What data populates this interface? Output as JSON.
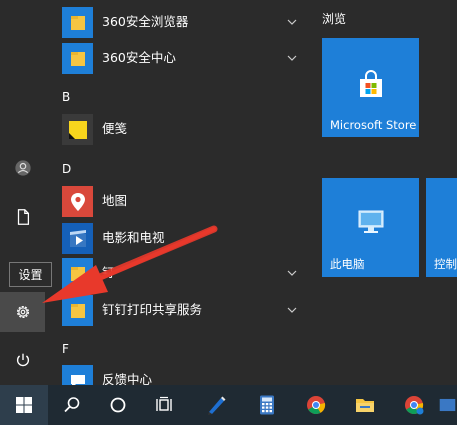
{
  "colors": {
    "background": "#2b2b2b",
    "tile_blue": "#1e7fd8",
    "folder_yellow": "#f5c542",
    "taskbar": "#1f2a33",
    "arrow_red": "#e8392b"
  },
  "rail": {
    "tooltip": "设置",
    "buttons": [
      "user-icon",
      "document-icon",
      "settings-icon",
      "power-icon"
    ]
  },
  "applist": {
    "apps": [
      {
        "label": "360安全浏览器",
        "icon": "folder-icon",
        "expandable": true
      },
      {
        "label": "360安全中心",
        "icon": "folder-icon",
        "expandable": true
      },
      {
        "label": "便笺",
        "icon": "sticky-notes-icon",
        "expandable": false
      },
      {
        "label": "地图",
        "icon": "maps-icon",
        "expandable": false
      },
      {
        "label": "电影和电视",
        "icon": "movies-tv-icon",
        "expandable": false
      },
      {
        "label": "钉",
        "icon": "folder-icon",
        "expandable": true
      },
      {
        "label": "钉钉打印共享服务",
        "icon": "folder-icon",
        "expandable": true
      },
      {
        "label": "反馈中心",
        "icon": "feedback-icon",
        "expandable": false
      }
    ],
    "letters": [
      "B",
      "D",
      "F"
    ]
  },
  "tiles": {
    "group_title": "浏览",
    "items": [
      {
        "label": "Microsoft Store",
        "icon": "store-icon"
      },
      {
        "label": "此电脑",
        "icon": "this-pc-icon"
      },
      {
        "label": "控制",
        "icon": "control-panel-icon"
      }
    ]
  },
  "taskbar": {
    "items": [
      "windows-start-icon",
      "search-icon",
      "cortana-icon",
      "task-view-icon",
      "pen-app-icon",
      "calculator-icon",
      "chrome-icon",
      "file-explorer-icon",
      "chrome-icon"
    ]
  }
}
